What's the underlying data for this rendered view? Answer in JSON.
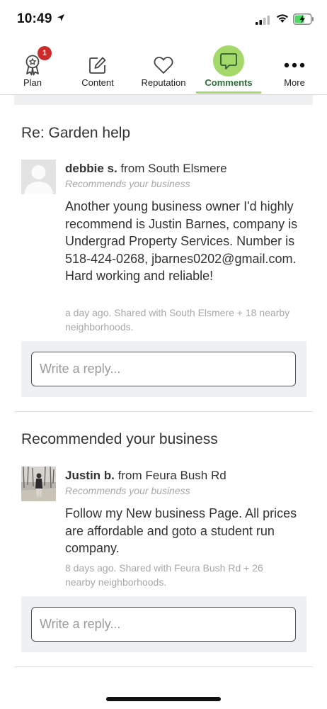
{
  "status": {
    "time": "10:49"
  },
  "tabs": [
    {
      "label": "Plan",
      "badge": "1"
    },
    {
      "label": "Content"
    },
    {
      "label": "Reputation"
    },
    {
      "label": "Comments"
    },
    {
      "label": "More"
    }
  ],
  "posts": [
    {
      "title": "Re: Garden help",
      "author_name": "debbie s.",
      "author_location": "from South Elsmere",
      "subtitle": "Recommends your business",
      "body": "Another young business owner I'd highly recommend is Justin Barnes, company is Undergrad Property Services. Number is 518-424-0268, jbarnes0202@gmail.com. Hard working and reliable!",
      "meta": "a day ago. Shared with South Elsmere + 18 nearby neighborhoods.",
      "reply_placeholder": "Write a reply..."
    },
    {
      "title": "Recommended your business",
      "author_name": "Justin b.",
      "author_location": "from Feura Bush Rd",
      "subtitle": "Recommends your business",
      "body": "Follow my New business Page. All prices are affordable and goto a student run company.",
      "meta": "8 days ago. Shared with Feura Bush Rd + 26 nearby neighborhoods.",
      "reply_placeholder": "Write a reply..."
    }
  ]
}
